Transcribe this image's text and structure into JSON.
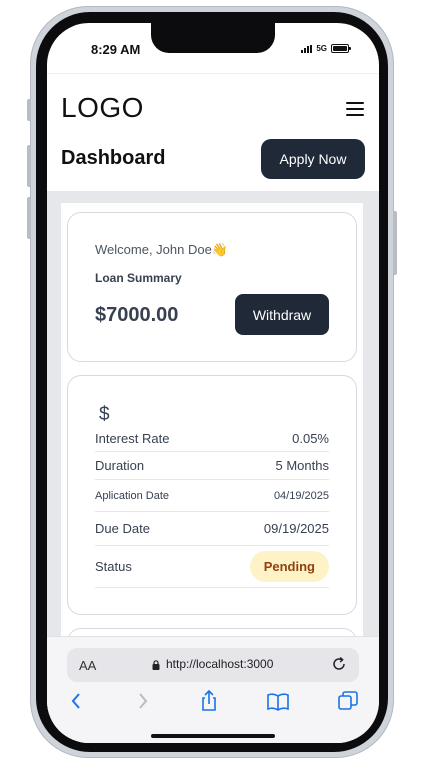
{
  "status_bar": {
    "time": "8:29 AM",
    "network": "5G"
  },
  "header": {
    "logo": "LOGO",
    "title": "Dashboard",
    "apply_label": "Apply Now"
  },
  "summary_card": {
    "welcome": "Welcome, John Doe👋",
    "label": "Loan Summary",
    "amount": "$7000.00",
    "withdraw_label": "Withdraw"
  },
  "loan_card": {
    "icon_symbol": "$",
    "rows": [
      {
        "label": "Interest Rate",
        "value": "0.05%"
      },
      {
        "label": "Duration",
        "value": "5 Months"
      },
      {
        "label": "Aplication Date",
        "value": "04/19/2025"
      },
      {
        "label": "Due Date",
        "value": "09/19/2025"
      },
      {
        "label": "Status",
        "value": "Pending"
      }
    ]
  },
  "browser": {
    "text_size_label": "AA",
    "url": "http://localhost:3000"
  },
  "colors": {
    "primary_button": "#1f2937",
    "status_pending_bg": "#fef3c7",
    "status_pending_text": "#92400e",
    "content_bg": "#e5e7eb",
    "ios_link_blue": "#1a73e8"
  }
}
